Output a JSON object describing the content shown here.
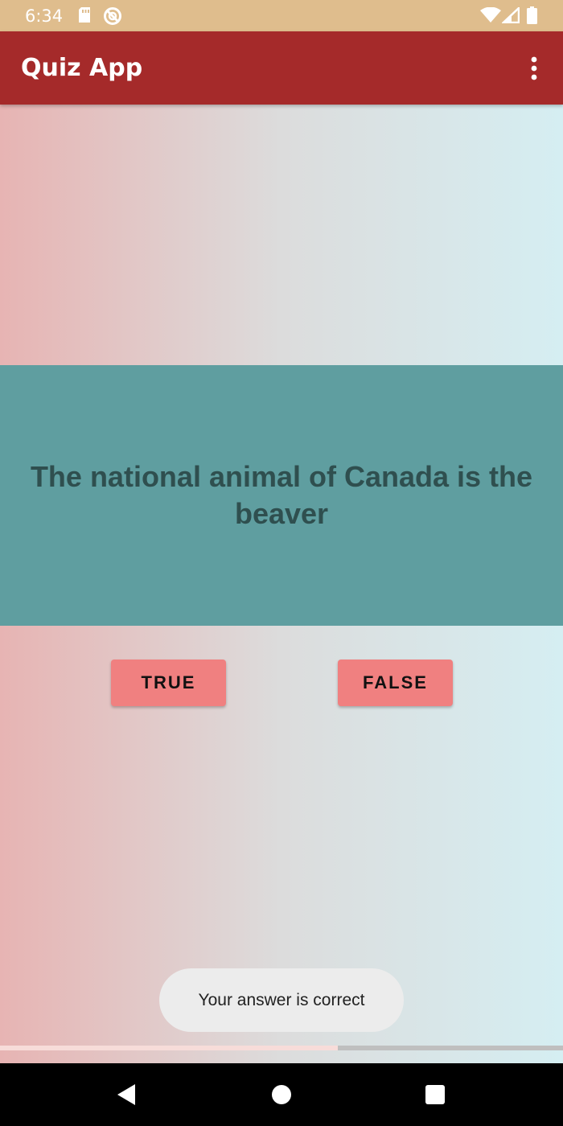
{
  "status_bar": {
    "time": "6:34",
    "icons": [
      "sd-card-icon",
      "do-not-disturb-icon",
      "wifi-icon",
      "cell-signal-icon",
      "battery-icon"
    ]
  },
  "app_bar": {
    "title": "Quiz App",
    "menu_icon": "more-vert-icon",
    "background": "#a52a2a"
  },
  "question": {
    "text": "The national animal of Canada is the beaver",
    "panel_color": "#5f9ea0",
    "text_color": "#2f4f4f"
  },
  "answers": {
    "true_label": "TRUE",
    "false_label": "FALSE",
    "button_color": "#f08080"
  },
  "toast": {
    "message": "Your answer is correct"
  },
  "progress": {
    "value": 0.6
  },
  "nav_bar": {
    "icons": [
      "back-icon",
      "home-icon",
      "recents-icon"
    ]
  }
}
